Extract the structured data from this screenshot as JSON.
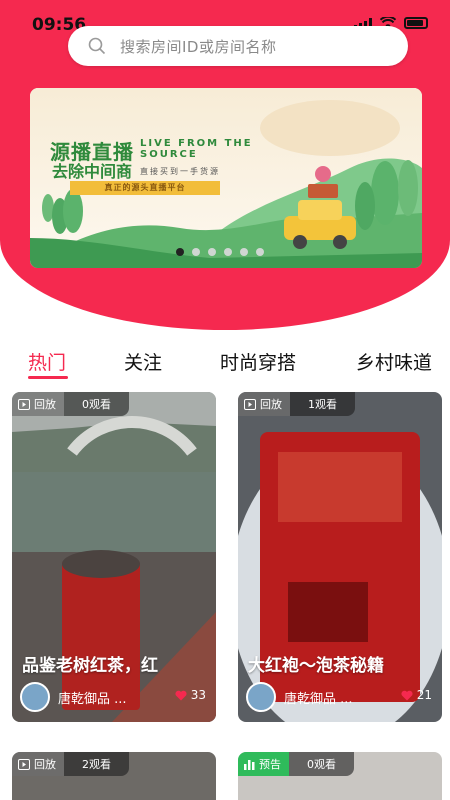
{
  "status": {
    "time": "09:56"
  },
  "search": {
    "placeholder": "搜索房间ID或房间名称"
  },
  "banner": {
    "title1": "源播直播",
    "title2": "去除中间商",
    "english": "LIVE FROM THE SOURCE",
    "subtitle": "直接买到一手货源",
    "strip": "真正的源头直播平台",
    "dots_total": 6,
    "dots_active": 0
  },
  "tabs": [
    {
      "label": "热门",
      "active": true
    },
    {
      "label": "关注",
      "active": false
    },
    {
      "label": "时尚穿搭",
      "active": false
    },
    {
      "label": "乡村味道",
      "active": false
    }
  ],
  "cards": [
    {
      "status": "回放",
      "views": "0观看",
      "title": "品鉴老树红茶，红",
      "author": "唐乾御品 ...",
      "likes": "33"
    },
    {
      "status": "回放",
      "views": "1观看",
      "title": "大红袍～泡茶秘籍",
      "author": "唐乾御品 ...",
      "likes": "21"
    },
    {
      "status": "回放",
      "views": "2观看"
    },
    {
      "status": "预告",
      "views": "0观看"
    }
  ],
  "colors": {
    "brand": "#f5294f",
    "preview_badge": "#2fbb5b",
    "banner_green": "#2f8a3c"
  }
}
